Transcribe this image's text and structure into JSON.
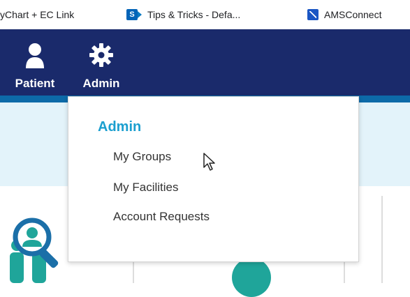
{
  "bookmarks": {
    "item1": "yChart + EC Link",
    "item2_icon": "S",
    "item2": "Tips & Tricks - Defa...",
    "item3": "AMSConnect"
  },
  "nav": {
    "patient_label": "Patient",
    "admin_label": "Admin"
  },
  "dropdown": {
    "heading": "Admin",
    "items": [
      "My Groups",
      "My Facilities",
      "Account Requests"
    ]
  },
  "colors": {
    "navbar": "#1a2a6b",
    "accent": "#1b9fcf",
    "banner": "#e3f3fa"
  }
}
